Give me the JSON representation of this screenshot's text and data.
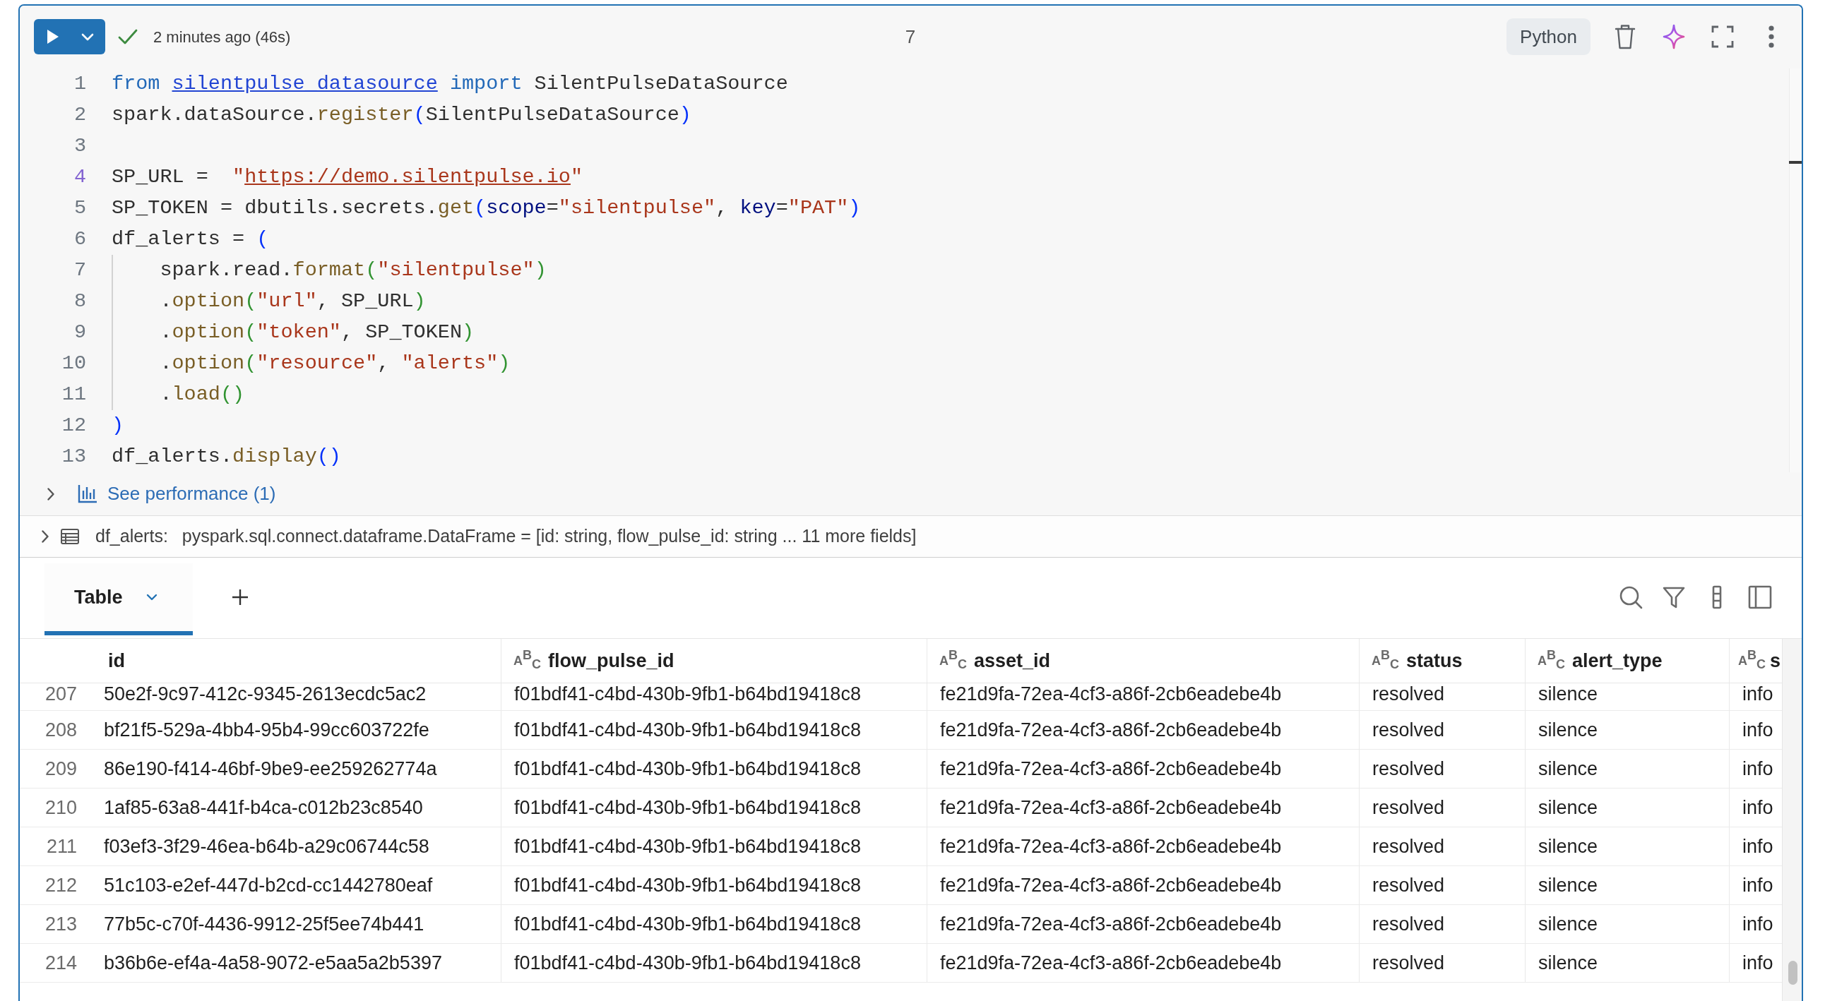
{
  "cell": {
    "run_status": {
      "success": true,
      "text": "2 minutes ago (46s)"
    },
    "execution_count": "7",
    "language": "Python",
    "code": [
      {
        "number": "1",
        "current": false,
        "tokens": [
          {
            "kind": "keyword",
            "text": "from "
          },
          {
            "kind": "module",
            "text": "silentpulse_datasource"
          },
          {
            "kind": "keyword",
            "text": " import"
          },
          {
            "kind": "plain",
            "text": " SilentPulseDataSource"
          }
        ]
      },
      {
        "number": "2",
        "current": false,
        "tokens": [
          {
            "kind": "plain",
            "text": "spark.dataSource."
          },
          {
            "kind": "function",
            "text": "register"
          },
          {
            "kind": "bracket",
            "text": "("
          },
          {
            "kind": "plain",
            "text": "SilentPulseDataSource"
          },
          {
            "kind": "bracket",
            "text": ")"
          }
        ]
      },
      {
        "number": "3",
        "current": false
      },
      {
        "number": "4",
        "current": true,
        "tokens": [
          {
            "kind": "plain",
            "text": "SP_URL =  "
          },
          {
            "kind": "string",
            "text": "\""
          },
          {
            "kind": "url",
            "text": "https://demo.silentpulse.io"
          },
          {
            "kind": "string",
            "text": "\""
          }
        ]
      },
      {
        "number": "5",
        "current": false,
        "tokens": [
          {
            "kind": "plain",
            "text": "SP_TOKEN = dbutils.secrets."
          },
          {
            "kind": "function",
            "text": "get"
          },
          {
            "kind": "bracket",
            "text": "("
          },
          {
            "kind": "parameter",
            "text": "scope"
          },
          {
            "kind": "plain",
            "text": "="
          },
          {
            "kind": "string",
            "text": "\"silentpulse\""
          },
          {
            "kind": "plain",
            "text": ", "
          },
          {
            "kind": "parameter",
            "text": "key"
          },
          {
            "kind": "plain",
            "text": "="
          },
          {
            "kind": "string",
            "text": "\"PAT\""
          },
          {
            "kind": "bracket",
            "text": ")"
          }
        ]
      },
      {
        "number": "6",
        "current": false,
        "tokens": [
          {
            "kind": "plain",
            "text": "df_alerts = "
          },
          {
            "kind": "bracket",
            "text": "("
          }
        ]
      },
      {
        "number": "7",
        "current": false,
        "tokens": [
          {
            "kind": "plain",
            "text": "    spark.read."
          },
          {
            "kind": "function",
            "text": "format"
          },
          {
            "kind": "nested_bracket",
            "text": "("
          },
          {
            "kind": "string",
            "text": "\"silentpulse\""
          },
          {
            "kind": "nested_bracket",
            "text": ")"
          }
        ]
      },
      {
        "number": "8",
        "current": false,
        "tokens": [
          {
            "kind": "plain",
            "text": "    ."
          },
          {
            "kind": "function",
            "text": "option"
          },
          {
            "kind": "nested_bracket",
            "text": "("
          },
          {
            "kind": "string",
            "text": "\"url\""
          },
          {
            "kind": "plain",
            "text": ", SP_URL"
          },
          {
            "kind": "nested_bracket",
            "text": ")"
          }
        ]
      },
      {
        "number": "9",
        "current": false,
        "tokens": [
          {
            "kind": "plain",
            "text": "    ."
          },
          {
            "kind": "function",
            "text": "option"
          },
          {
            "kind": "nested_bracket",
            "text": "("
          },
          {
            "kind": "string",
            "text": "\"token\""
          },
          {
            "kind": "plain",
            "text": ", SP_TOKEN"
          },
          {
            "kind": "nested_bracket",
            "text": ")"
          }
        ]
      },
      {
        "number": "10",
        "current": false,
        "tokens": [
          {
            "kind": "plain",
            "text": "    ."
          },
          {
            "kind": "function",
            "text": "option"
          },
          {
            "kind": "nested_bracket",
            "text": "("
          },
          {
            "kind": "string",
            "text": "\"resource\""
          },
          {
            "kind": "plain",
            "text": ", "
          },
          {
            "kind": "string",
            "text": "\"alerts\""
          },
          {
            "kind": "nested_bracket",
            "text": ")"
          }
        ]
      },
      {
        "number": "11",
        "current": false,
        "tokens": [
          {
            "kind": "plain",
            "text": "    ."
          },
          {
            "kind": "function",
            "text": "load"
          },
          {
            "kind": "nested_bracket",
            "text": "()"
          }
        ]
      },
      {
        "number": "12",
        "current": false,
        "tokens": [
          {
            "kind": "bracket",
            "text": ")"
          }
        ]
      },
      {
        "number": "13",
        "current": false,
        "tokens": [
          {
            "kind": "plain",
            "text": "df_alerts."
          },
          {
            "kind": "function",
            "text": "display"
          },
          {
            "kind": "bracket",
            "text": "()"
          }
        ]
      }
    ],
    "performance": {
      "label": "See performance (1)",
      "expanded": false
    },
    "dataframe": {
      "expanded": false,
      "name": "df_alerts:",
      "schema": "pyspark.sql.connect.dataframe.DataFrame = [id: string, flow_pulse_id: string ... 11 more fields]"
    }
  },
  "results": {
    "tabs": [
      {
        "label": "Table",
        "selected": true
      }
    ],
    "table": {
      "columns": [
        {
          "label": "id"
        },
        {
          "type": "A$^{B}$$_{C}$",
          "label": "flow_pulse_id"
        },
        {
          "type": "A$^{B}$$_{C}$",
          "label": "asset_id"
        },
        {
          "type": "A$^{B}$$_{C}$",
          "label": "status"
        },
        {
          "type": "A$^{B}$$_{C}$",
          "label": "alert_type"
        },
        {
          "type": "A$^{B}$$_{C}$",
          "label": "s"
        }
      ],
      "rows": [
        {
          "number": "207",
          "cells": [
            "50e2f-9c97-412c-9345-2613ecdc5ac2",
            "f01bdf41-c4bd-430b-9fb1-b64bd19418c8",
            "fe21d9fa-72ea-4cf3-a86f-2cb6eadebe4b",
            "resolved",
            "silence",
            "info"
          ]
        },
        {
          "number": "208",
          "cells": [
            "bf21f5-529a-4bb4-95b4-99cc603722fe",
            "f01bdf41-c4bd-430b-9fb1-b64bd19418c8",
            "fe21d9fa-72ea-4cf3-a86f-2cb6eadebe4b",
            "resolved",
            "silence",
            "info"
          ]
        },
        {
          "number": "209",
          "cells": [
            "86e190-f414-46bf-9be9-ee259262774a",
            "f01bdf41-c4bd-430b-9fb1-b64bd19418c8",
            "fe21d9fa-72ea-4cf3-a86f-2cb6eadebe4b",
            "resolved",
            "silence",
            "info"
          ]
        },
        {
          "number": "210",
          "cells": [
            "1af85-63a8-441f-b4ca-c012b23c8540",
            "f01bdf41-c4bd-430b-9fb1-b64bd19418c8",
            "fe21d9fa-72ea-4cf3-a86f-2cb6eadebe4b",
            "resolved",
            "silence",
            "info"
          ]
        },
        {
          "number": "211",
          "cells": [
            "f03ef3-3f29-46ea-b64b-a29c06744c58",
            "f01bdf41-c4bd-430b-9fb1-b64bd19418c8",
            "fe21d9fa-72ea-4cf3-a86f-2cb6eadebe4b",
            "resolved",
            "silence",
            "info"
          ]
        },
        {
          "number": "212",
          "cells": [
            "51c103-e2ef-447d-b2cd-cc1442780eaf",
            "f01bdf41-c4bd-430b-9fb1-b64bd19418c8",
            "fe21d9fa-72ea-4cf3-a86f-2cb6eadebe4b",
            "resolved",
            "silence",
            "info"
          ]
        },
        {
          "number": "213",
          "cells": [
            "77b5c-c70f-4436-9912-25f5ee74b441",
            "f01bdf41-c4bd-430b-9fb1-b64bd19418c8",
            "fe21d9fa-72ea-4cf3-a86f-2cb6eadebe4b",
            "resolved",
            "silence",
            "info"
          ]
        },
        {
          "number": "214",
          "cells": [
            "b36b6e-ef4a-4a58-9072-e5aa5a2b5397",
            "f01bdf41-c4bd-430b-9fb1-b64bd19418c8",
            "fe21d9fa-72ea-4cf3-a86f-2cb6eadebe4b",
            "resolved",
            "silence",
            "info"
          ]
        }
      ]
    }
  }
}
